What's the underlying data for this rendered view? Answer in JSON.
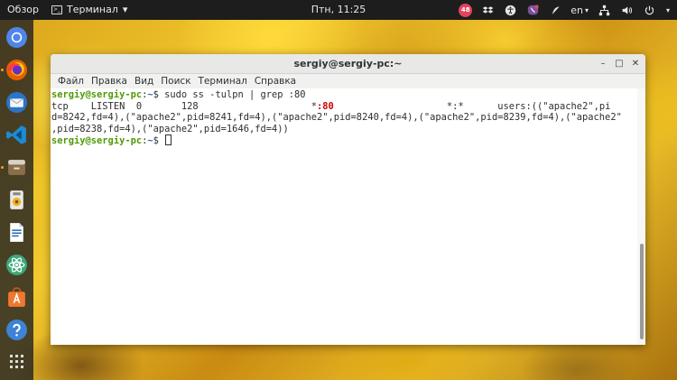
{
  "topbar": {
    "activities": "Обзор",
    "app_name": "Терминал",
    "app_caret": "▾",
    "clock": "Птн, 11:25",
    "notif_count": "48",
    "lang": "en",
    "lang_caret": "▾"
  },
  "dock": {
    "icons": [
      "chromium-icon",
      "firefox-icon",
      "thunderbird-icon",
      "vscode-icon",
      "files-icon",
      "rhythmbox-icon",
      "libreoffice-writer-icon",
      "atom-icon",
      "software-center-icon",
      "help-icon",
      "show-apps-icon"
    ]
  },
  "window": {
    "title": "sergiy@sergiy-pc:~",
    "controls": {
      "minimize": "–",
      "maximize": "□",
      "close": "✕"
    },
    "menu": [
      "Файл",
      "Правка",
      "Вид",
      "Поиск",
      "Терминал",
      "Справка"
    ]
  },
  "terminal": {
    "prompt_user": "sergiy@sergiy-pc",
    "prompt_sep": ":",
    "prompt_path": "~",
    "prompt_dollar": "$ ",
    "command": "sudo ss -tulpn | grep :80",
    "out1_pre": "tcp    LISTEN  0       128                    *",
    "out1_port": ":80",
    "out1_post": "                    *:*      users:((\"apache2\",pi",
    "out2": "d=8242,fd=4),(\"apache2\",pid=8241,fd=4),(\"apache2\",pid=8240,fd=4),(\"apache2\",pid=8239,fd=4),(\"apache2\"",
    "out3": ",pid=8238,fd=4),(\"apache2\",pid=1646,fd=4))"
  },
  "colors": {
    "prompt": "#4e9a06",
    "path": "#3465a4",
    "port": "#cc0000",
    "accent": "#f2a02a"
  }
}
